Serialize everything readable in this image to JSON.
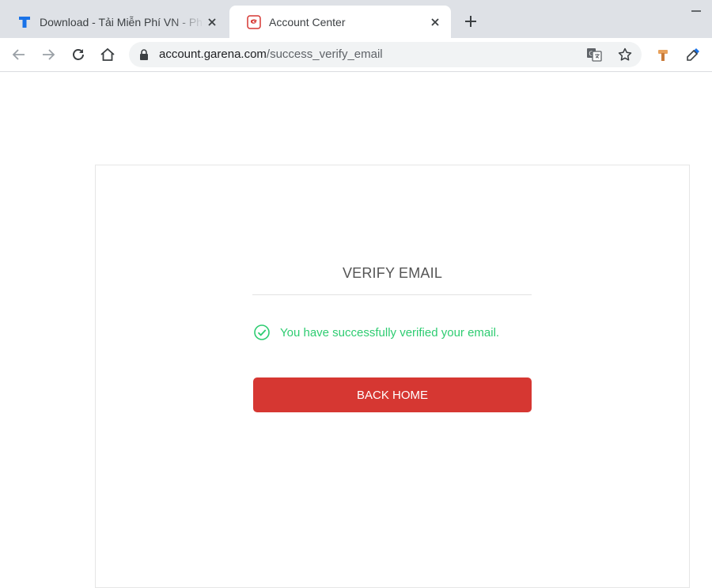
{
  "browser": {
    "tabs": [
      {
        "title": "Download - Tải Miễn Phí VN - Ph",
        "favicon": "t-letter-icon",
        "active": false
      },
      {
        "title": "Account Center",
        "favicon": "garena-logo-icon",
        "active": true
      }
    ],
    "address_bar": {
      "host": "account.garena.com",
      "path": "/success_verify_email"
    }
  },
  "page": {
    "heading": "VERIFY EMAIL",
    "success_message": "You have successfully verified your email.",
    "back_home_label": "BACK HOME"
  },
  "colors": {
    "success": "#2ecc71",
    "button": "#d63732",
    "tabstrip": "#dee1e6"
  }
}
